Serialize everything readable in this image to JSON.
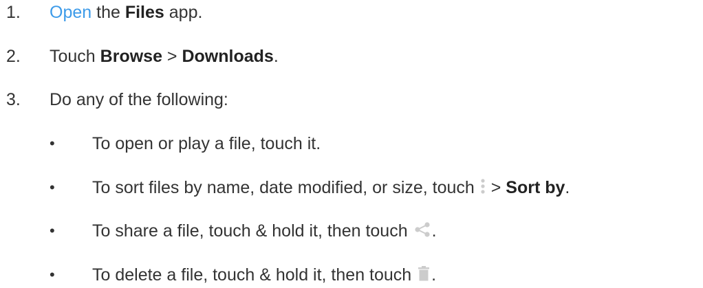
{
  "steps": [
    {
      "number": "1.",
      "link": "Open",
      "pre": " the ",
      "bold": "Files",
      "post": " app."
    },
    {
      "number": "2.",
      "pre": "Touch ",
      "bold1": "Browse",
      "sep": " > ",
      "bold2": "Downloads",
      "post": "."
    },
    {
      "number": "3.",
      "text": "Do any of the following:"
    }
  ],
  "bullets": [
    {
      "marker": "•",
      "text": "To open or play a file, touch it."
    },
    {
      "marker": "•",
      "pre": "To sort files by name, date modified, or size, touch ",
      "icon": "more-vert-icon",
      "sep": " > ",
      "bold": "Sort by",
      "post": "."
    },
    {
      "marker": "•",
      "pre": "To share a file, touch & hold it, then touch ",
      "icon": "share-icon",
      "post": "."
    },
    {
      "marker": "•",
      "pre": "To delete a file, touch & hold it, then touch ",
      "icon": "trash-icon",
      "post": "."
    }
  ],
  "colors": {
    "link": "#3d9be9",
    "icon": "#cccccc",
    "text": "#333333"
  }
}
